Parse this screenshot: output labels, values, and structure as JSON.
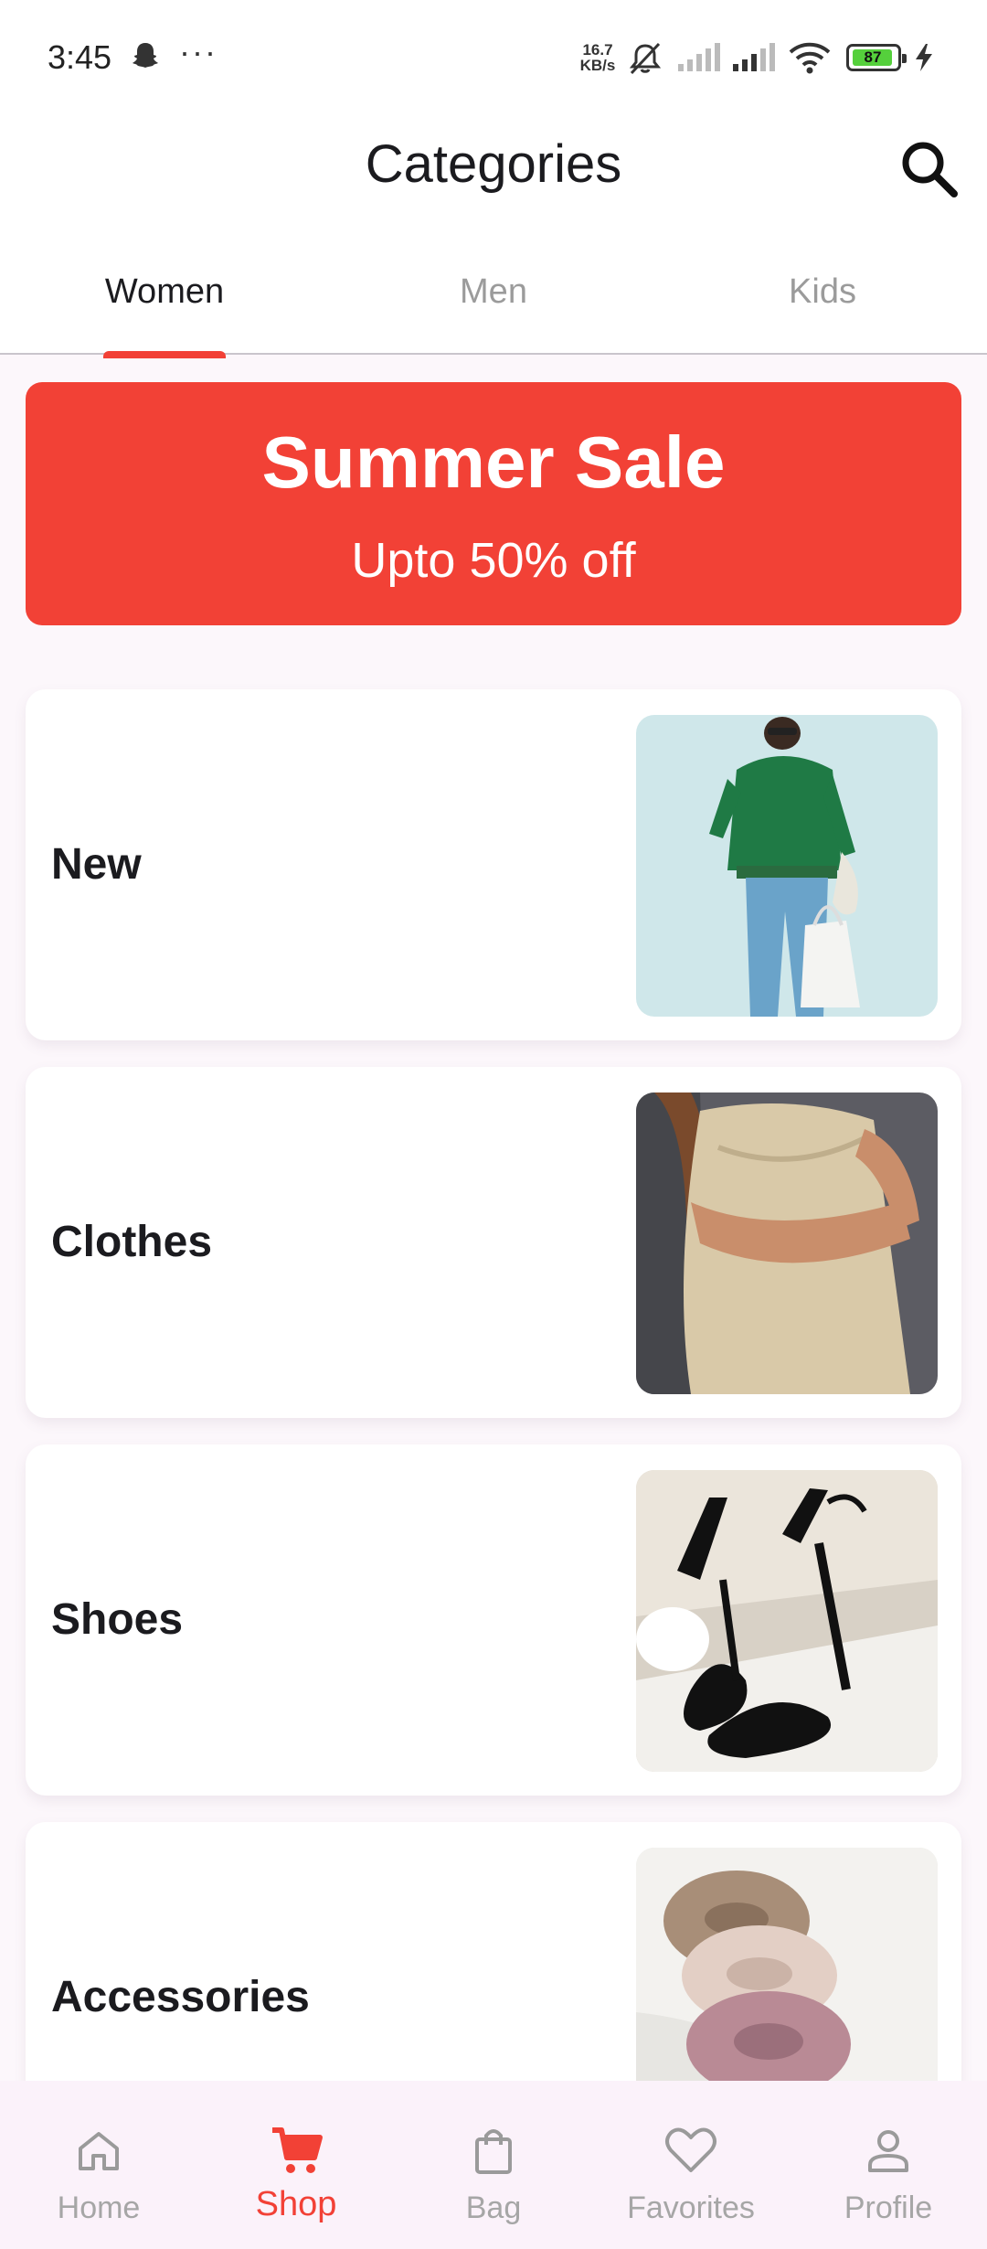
{
  "status_bar": {
    "time": "3:45",
    "more": "···",
    "speed_value": "16.7",
    "speed_unit": "KB/s",
    "battery": "87",
    "icons": [
      "snapchat-ghost-icon",
      "mute-icon",
      "signal-icon",
      "signal-icon",
      "wifi-icon",
      "battery-icon",
      "charging-icon"
    ]
  },
  "header": {
    "title": "Categories",
    "search_icon": "search-icon"
  },
  "tabs": [
    {
      "label": "Women",
      "active": true
    },
    {
      "label": "Men",
      "active": false
    },
    {
      "label": "Kids",
      "active": false
    }
  ],
  "banner": {
    "title": "Summer Sale",
    "subtitle": "Upto 50% off",
    "color": "#f24136"
  },
  "categories": [
    {
      "label": "New",
      "image": "woman-green-sweater-photo"
    },
    {
      "label": "Clothes",
      "image": "satin-dress-photo"
    },
    {
      "label": "Shoes",
      "image": "black-heels-photo"
    },
    {
      "label": "Accessories",
      "image": "scrunchies-photo"
    }
  ],
  "bottom_nav": [
    {
      "label": "Home",
      "icon": "home-icon",
      "active": false
    },
    {
      "label": "Shop",
      "icon": "cart-icon",
      "active": true
    },
    {
      "label": "Bag",
      "icon": "bag-icon",
      "active": false
    },
    {
      "label": "Favorites",
      "icon": "heart-icon",
      "active": false
    },
    {
      "label": "Profile",
      "icon": "profile-icon",
      "active": false
    }
  ],
  "colors": {
    "accent": "#f24136",
    "background": "#fcf7fb",
    "inactive": "#a6a6a6"
  }
}
